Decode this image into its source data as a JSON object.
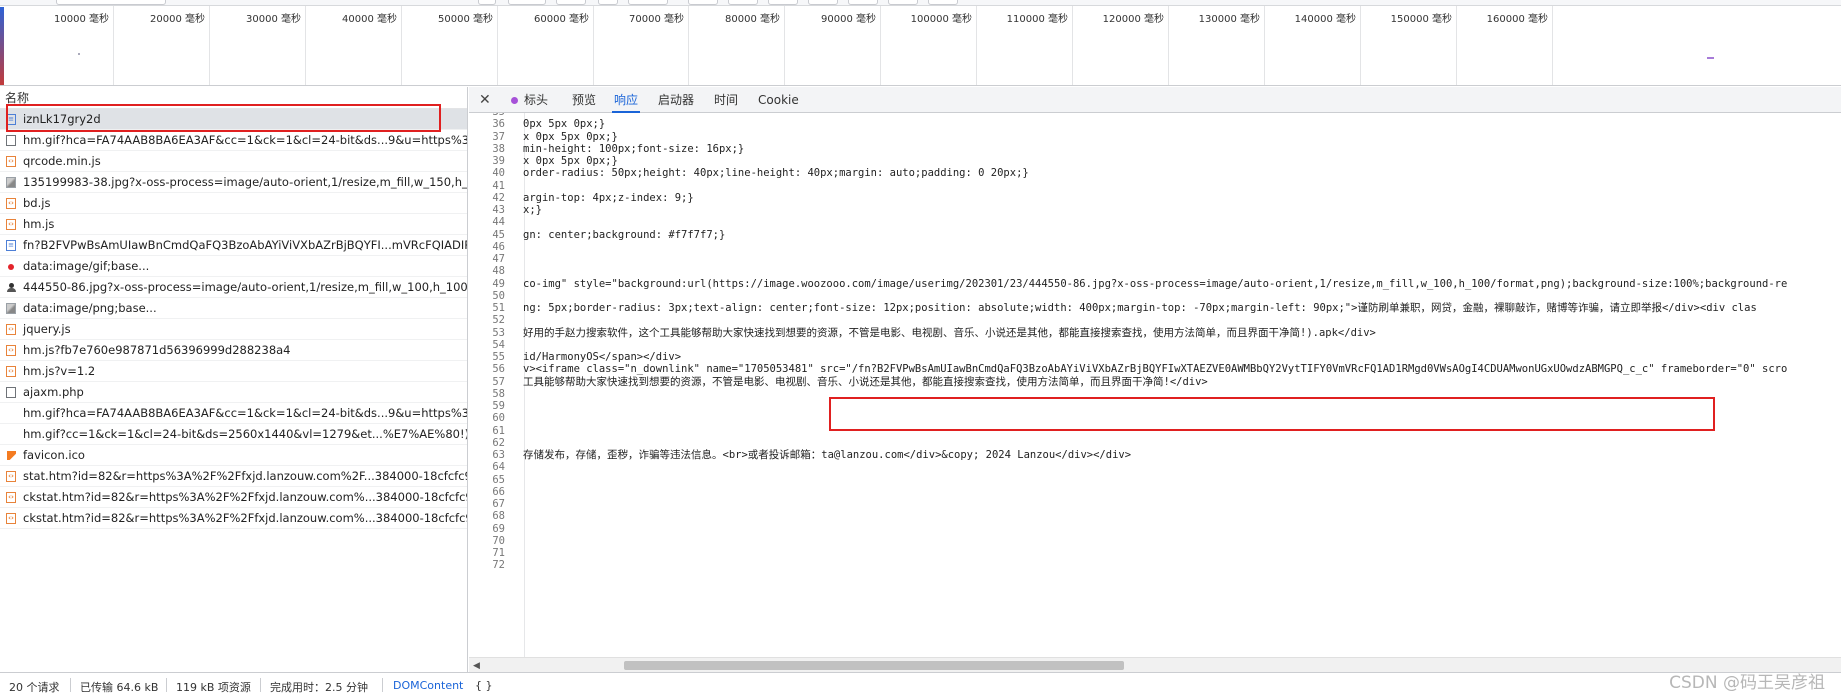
{
  "timeline": {
    "ticks": [
      "10000 毫秒",
      "20000 毫秒",
      "30000 毫秒",
      "40000 毫秒",
      "50000 毫秒",
      "60000 毫秒",
      "70000 毫秒",
      "80000 毫秒",
      "90000 毫秒",
      "100000 毫秒",
      "110000 毫秒",
      "120000 毫秒",
      "130000 毫秒",
      "140000 毫秒",
      "150000 毫秒",
      "160000 毫秒"
    ]
  },
  "request_list": {
    "header": "名称",
    "items": [
      {
        "name": "iznLk17gry2d",
        "icon": "document-icon"
      },
      {
        "name": "hm.gif?hca=FA74AAB8BA6EA3AF&cc=1&ck=1&cl=24-bit&ds...9&u=https%3A%...",
        "icon": "file-icon"
      },
      {
        "name": "qrcode.min.js",
        "icon": "script-icon"
      },
      {
        "name": "135199983-38.jpg?x-oss-process=image/auto-orient,1/resize,m_fill,w_150,h_150/...",
        "icon": "image-icon"
      },
      {
        "name": "bd.js",
        "icon": "script-icon"
      },
      {
        "name": "hm.js",
        "icon": "script-icon"
      },
      {
        "name": "fn?B2FVPwBsAmUIawBnCmdQaFQ3BzoAbAYiViVXbAZrBjBQYFI...mVRcFQIADIRM...",
        "icon": "document-icon"
      },
      {
        "name": "data:image/gif;base...",
        "icon": "red-dot-icon"
      },
      {
        "name": "444550-86.jpg?x-oss-process=image/auto-orient,1/resize,m_fill,w_100,h_100/for...",
        "icon": "person-icon"
      },
      {
        "name": "data:image/png;base...",
        "icon": "image-icon"
      },
      {
        "name": "jquery.js",
        "icon": "script-icon"
      },
      {
        "name": "hm.js?fb7e760e987871d56396999d288238a4",
        "icon": "script-icon"
      },
      {
        "name": "hm.js?v=1.2",
        "icon": "script-icon"
      },
      {
        "name": "ajaxm.php",
        "icon": "file-icon"
      },
      {
        "name": "hm.gif?hca=FA74AAB8BA6EA3AF&cc=1&ck=1&cl=24-bit&ds...9&u=https%3A%...",
        "icon": "blank"
      },
      {
        "name": "hm.gif?cc=1&ck=1&cl=24-bit&ds=2560x1440&vl=1279&et...%E7%AE%80!).apk...",
        "icon": "blank"
      },
      {
        "name": "favicon.ico",
        "icon": "favicon-icon"
      },
      {
        "name": "stat.htm?id=82&r=https%3A%2F%2Ffxjd.lanzouw.com%2F...384000-18cfcfc9244...",
        "icon": "script-icon"
      },
      {
        "name": "ckstat.htm?id=82&r=https%3A%2F%2Ffxjd.lanzouw.com%...384000-18cfcfc9244...",
        "icon": "script-icon"
      },
      {
        "name": "ckstat.htm?id=82&r=https%3A%2F%2Ffxjd.lanzouw.com%...384000-18cfcfc9244...",
        "icon": "script-icon"
      }
    ]
  },
  "detail": {
    "close_label": "✕",
    "tabs": [
      "标头",
      "预览",
      "响应",
      "启动器",
      "时间",
      "Cookie"
    ],
    "active_tab": "响应",
    "lines": [
      {
        "n": "35",
        "text": ""
      },
      {
        "n": "36",
        "text": "0px 5px 0px;}"
      },
      {
        "n": "37",
        "text": "x 0px 5px 0px;}"
      },
      {
        "n": "38",
        "text": "min-height: 100px;font-size: 16px;}"
      },
      {
        "n": "39",
        "text": "x 0px 5px 0px;}"
      },
      {
        "n": "40",
        "text": "order-radius: 50px;height: 40px;line-height: 40px;margin: auto;padding: 0 20px;}"
      },
      {
        "n": "41",
        "text": ""
      },
      {
        "n": "42",
        "text": "argin-top: 4px;z-index: 9;}"
      },
      {
        "n": "43",
        "text": "x;}"
      },
      {
        "n": "44",
        "text": ""
      },
      {
        "n": "45",
        "text": "gn: center;background: #f7f7f7;}"
      },
      {
        "n": "46",
        "text": ""
      },
      {
        "n": "47",
        "text": ""
      },
      {
        "n": "48",
        "text": ""
      },
      {
        "n": "49",
        "text": "co-img\" style=\"background:url(https://image.woozooo.com/image/userimg/202301/23/444550-86.jpg?x-oss-process=image/auto-orient,1/resize,m_fill,w_100,h_100/format,png);background-size:100%;background-re"
      },
      {
        "n": "50",
        "text": ""
      },
      {
        "n": "51",
        "text": "ng: 5px;border-radius: 3px;text-align: center;font-size: 12px;position: absolute;width: 400px;margin-top: -70px;margin-left: 90px;\">谨防刷单兼职，网贷，金融，裸聊敲诈，赌博等诈骗，请立即举报</div><div clas"
      },
      {
        "n": "52",
        "text": ""
      },
      {
        "n": "53",
        "text": "好用的手赵力搜索软件，这个工具能够帮助大家快速找到想要的资源，不管是电影、电视剧、音乐、小说还是其他，都能直接搜索查找，使用方法简单，而且界面干净简!).apk</div>"
      },
      {
        "n": "54",
        "text": ""
      },
      {
        "n": "55",
        "text": "id/HarmonyOS</span></div>"
      },
      {
        "n": "56",
        "text": "v><iframe class=\"n_downlink\" name=\"1705053481\" src=\"/fn?B2FVPwBsAmUIawBnCmdQaFQ3BzoAbAYiViVXbAZrBjBQYFIwXTAEZVE0AWMBbQY2VytTIFY0VmVRcFQ1AD1RMgd0VWsAOgI4CDUAMwonUGxUOwdzABMGPQ_c_c\" frameborder=\"0\" scro"
      },
      {
        "n": "57",
        "text": "工具能够帮助大家快速找到想要的资源，不管是电影、电视剧、音乐、小说还是其他，都能直接搜索查找，使用方法简单，而且界面干净简!</div>"
      },
      {
        "n": "58",
        "text": ""
      },
      {
        "n": "59",
        "text": ""
      },
      {
        "n": "60",
        "text": ""
      },
      {
        "n": "61",
        "text": ""
      },
      {
        "n": "62",
        "text": ""
      },
      {
        "n": "63",
        "text": "存储发布，存储，歪秽，诈骗等违法信息。<br>或者投诉邮箱：ta@lanzou.com</div>&copy; 2024 Lanzou</div></div>"
      },
      {
        "n": "64",
        "text": ""
      },
      {
        "n": "65",
        "text": ""
      },
      {
        "n": "66",
        "text": ""
      },
      {
        "n": "67",
        "text": ""
      },
      {
        "n": "68",
        "text": ""
      },
      {
        "n": "69",
        "text": ""
      },
      {
        "n": "70",
        "text": ""
      },
      {
        "n": "71",
        "text": ""
      },
      {
        "n": "72",
        "text": ""
      }
    ]
  },
  "status": {
    "requests": "20 个请求",
    "transferred": "已传输 64.6 kB",
    "resources": "119 kB 项资源",
    "finish": "完成用时：2.5 分钟",
    "domcontent": "DOMContent",
    "braces": "{ }"
  },
  "watermark": "CSDN @码王吴彦祖",
  "colors": {
    "accent": "#1a64d8",
    "highlight_box": "#e02020",
    "selected_row": "#dfe2e6"
  }
}
